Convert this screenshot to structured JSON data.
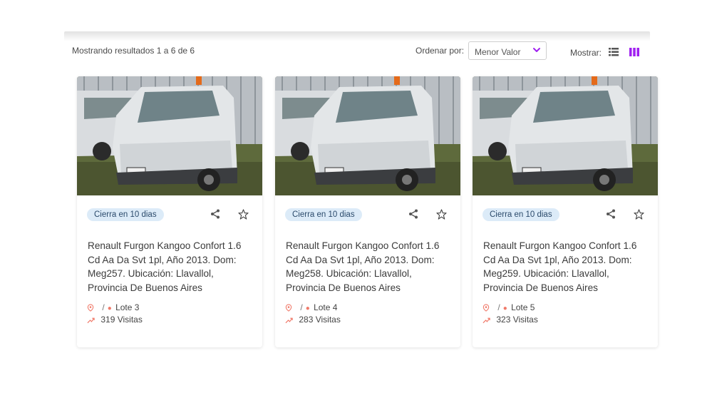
{
  "toolbar": {
    "results_text": "Mostrando resultados 1 a 6 de 6",
    "sort_label": "Ordenar por:",
    "sort_value": "Menor Valor",
    "show_label": "Mostrar:",
    "active_view": "grid",
    "accent_color": "#a020f0"
  },
  "cards": [
    {
      "badge": "Cierra en 10 dias",
      "title": "Renault Furgon Kangoo Confort 1.6 Cd Aa Da Svt 1pl, Año 2013. Dom: Meg257. Ubicación: Llavallol, Provincia De Buenos Aires",
      "lot": "Lote 3",
      "visits": "319",
      "visits_label": "Visitas",
      "location_separator": "/"
    },
    {
      "badge": "Cierra en 10 dias",
      "title": "Renault Furgon Kangoo Confort 1.6 Cd Aa Da Svt 1pl, Año 2013. Dom: Meg258. Ubicación: Llavallol, Provincia De Buenos Aires",
      "lot": "Lote 4",
      "visits": "283",
      "visits_label": "Visitas",
      "location_separator": "/"
    },
    {
      "badge": "Cierra en 10 dias",
      "title": "Renault Furgon Kangoo Confort 1.6 Cd Aa Da Svt 1pl, Año 2013. Dom: Meg259. Ubicación: Llavallol, Provincia De Buenos Aires",
      "lot": "Lote 5",
      "visits": "323",
      "visits_label": "Visitas",
      "location_separator": "/"
    }
  ]
}
